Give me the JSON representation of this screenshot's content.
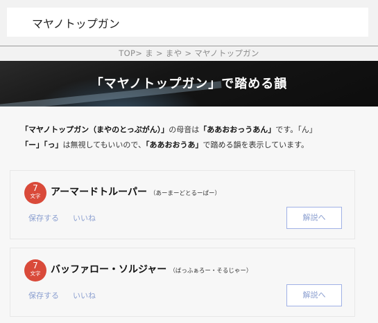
{
  "search": {
    "value": "マヤノトップガン"
  },
  "breadcrumb": {
    "items": [
      "TOP",
      "ま",
      "まや",
      "マヤノトップガン"
    ],
    "separators": [
      "> ",
      " > ",
      " > "
    ]
  },
  "hero": {
    "title": "「マヤノトップガン」で踏める韻"
  },
  "intro": {
    "q1": "「マヤノトップガン（まやのとっぷがん）」",
    "t1": "の母音は",
    "q2": "「ああおおっうあん」",
    "t2": "です。「ん」",
    "q3": "「ー」「っ」",
    "t3": "は無視してもいいので、",
    "q4": "「ああおおうあ」",
    "t4": "で踏める韻を表示しています。"
  },
  "results": [
    {
      "count": "7",
      "unit": "文字",
      "word": "アーマードトルーパー",
      "reading": "（あーまーどとるーぱー）",
      "save_label": "保存する",
      "like_label": "いいね",
      "explain_label": "解説へ"
    },
    {
      "count": "7",
      "unit": "文字",
      "word": "バッファロー・ソルジャー",
      "reading": "（ばっふぁろー・そるじゃー）",
      "save_label": "保存する",
      "like_label": "いいね",
      "explain_label": "解説へ"
    }
  ],
  "colors": {
    "badge": "#d94a3a",
    "link": "#8b9fd0",
    "button_border": "#9fb0e6"
  }
}
